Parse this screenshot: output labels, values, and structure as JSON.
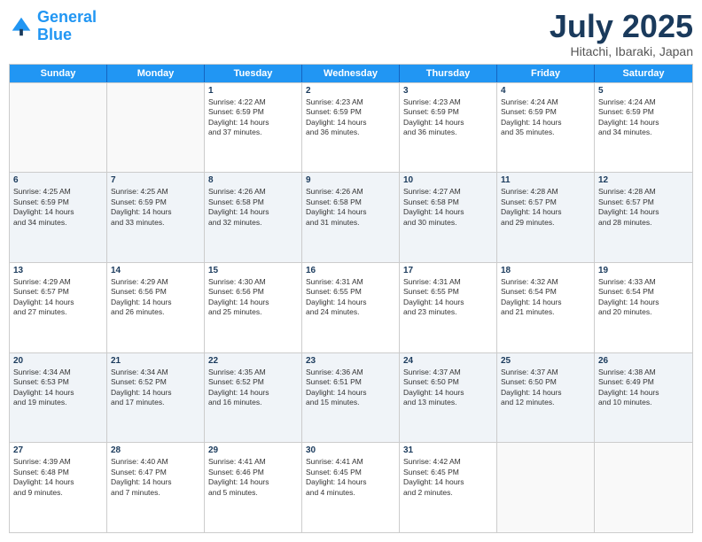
{
  "header": {
    "logo_general": "General",
    "logo_blue": "Blue",
    "month_title": "July 2025",
    "location": "Hitachi, Ibaraki, Japan"
  },
  "weekdays": [
    "Sunday",
    "Monday",
    "Tuesday",
    "Wednesday",
    "Thursday",
    "Friday",
    "Saturday"
  ],
  "rows": [
    [
      {
        "day": "",
        "detail": ""
      },
      {
        "day": "",
        "detail": ""
      },
      {
        "day": "1",
        "detail": "Sunrise: 4:22 AM\nSunset: 6:59 PM\nDaylight: 14 hours\nand 37 minutes."
      },
      {
        "day": "2",
        "detail": "Sunrise: 4:23 AM\nSunset: 6:59 PM\nDaylight: 14 hours\nand 36 minutes."
      },
      {
        "day": "3",
        "detail": "Sunrise: 4:23 AM\nSunset: 6:59 PM\nDaylight: 14 hours\nand 36 minutes."
      },
      {
        "day": "4",
        "detail": "Sunrise: 4:24 AM\nSunset: 6:59 PM\nDaylight: 14 hours\nand 35 minutes."
      },
      {
        "day": "5",
        "detail": "Sunrise: 4:24 AM\nSunset: 6:59 PM\nDaylight: 14 hours\nand 34 minutes."
      }
    ],
    [
      {
        "day": "6",
        "detail": "Sunrise: 4:25 AM\nSunset: 6:59 PM\nDaylight: 14 hours\nand 34 minutes."
      },
      {
        "day": "7",
        "detail": "Sunrise: 4:25 AM\nSunset: 6:59 PM\nDaylight: 14 hours\nand 33 minutes."
      },
      {
        "day": "8",
        "detail": "Sunrise: 4:26 AM\nSunset: 6:58 PM\nDaylight: 14 hours\nand 32 minutes."
      },
      {
        "day": "9",
        "detail": "Sunrise: 4:26 AM\nSunset: 6:58 PM\nDaylight: 14 hours\nand 31 minutes."
      },
      {
        "day": "10",
        "detail": "Sunrise: 4:27 AM\nSunset: 6:58 PM\nDaylight: 14 hours\nand 30 minutes."
      },
      {
        "day": "11",
        "detail": "Sunrise: 4:28 AM\nSunset: 6:57 PM\nDaylight: 14 hours\nand 29 minutes."
      },
      {
        "day": "12",
        "detail": "Sunrise: 4:28 AM\nSunset: 6:57 PM\nDaylight: 14 hours\nand 28 minutes."
      }
    ],
    [
      {
        "day": "13",
        "detail": "Sunrise: 4:29 AM\nSunset: 6:57 PM\nDaylight: 14 hours\nand 27 minutes."
      },
      {
        "day": "14",
        "detail": "Sunrise: 4:29 AM\nSunset: 6:56 PM\nDaylight: 14 hours\nand 26 minutes."
      },
      {
        "day": "15",
        "detail": "Sunrise: 4:30 AM\nSunset: 6:56 PM\nDaylight: 14 hours\nand 25 minutes."
      },
      {
        "day": "16",
        "detail": "Sunrise: 4:31 AM\nSunset: 6:55 PM\nDaylight: 14 hours\nand 24 minutes."
      },
      {
        "day": "17",
        "detail": "Sunrise: 4:31 AM\nSunset: 6:55 PM\nDaylight: 14 hours\nand 23 minutes."
      },
      {
        "day": "18",
        "detail": "Sunrise: 4:32 AM\nSunset: 6:54 PM\nDaylight: 14 hours\nand 21 minutes."
      },
      {
        "day": "19",
        "detail": "Sunrise: 4:33 AM\nSunset: 6:54 PM\nDaylight: 14 hours\nand 20 minutes."
      }
    ],
    [
      {
        "day": "20",
        "detail": "Sunrise: 4:34 AM\nSunset: 6:53 PM\nDaylight: 14 hours\nand 19 minutes."
      },
      {
        "day": "21",
        "detail": "Sunrise: 4:34 AM\nSunset: 6:52 PM\nDaylight: 14 hours\nand 17 minutes."
      },
      {
        "day": "22",
        "detail": "Sunrise: 4:35 AM\nSunset: 6:52 PM\nDaylight: 14 hours\nand 16 minutes."
      },
      {
        "day": "23",
        "detail": "Sunrise: 4:36 AM\nSunset: 6:51 PM\nDaylight: 14 hours\nand 15 minutes."
      },
      {
        "day": "24",
        "detail": "Sunrise: 4:37 AM\nSunset: 6:50 PM\nDaylight: 14 hours\nand 13 minutes."
      },
      {
        "day": "25",
        "detail": "Sunrise: 4:37 AM\nSunset: 6:50 PM\nDaylight: 14 hours\nand 12 minutes."
      },
      {
        "day": "26",
        "detail": "Sunrise: 4:38 AM\nSunset: 6:49 PM\nDaylight: 14 hours\nand 10 minutes."
      }
    ],
    [
      {
        "day": "27",
        "detail": "Sunrise: 4:39 AM\nSunset: 6:48 PM\nDaylight: 14 hours\nand 9 minutes."
      },
      {
        "day": "28",
        "detail": "Sunrise: 4:40 AM\nSunset: 6:47 PM\nDaylight: 14 hours\nand 7 minutes."
      },
      {
        "day": "29",
        "detail": "Sunrise: 4:41 AM\nSunset: 6:46 PM\nDaylight: 14 hours\nand 5 minutes."
      },
      {
        "day": "30",
        "detail": "Sunrise: 4:41 AM\nSunset: 6:45 PM\nDaylight: 14 hours\nand 4 minutes."
      },
      {
        "day": "31",
        "detail": "Sunrise: 4:42 AM\nSunset: 6:45 PM\nDaylight: 14 hours\nand 2 minutes."
      },
      {
        "day": "",
        "detail": ""
      },
      {
        "day": "",
        "detail": ""
      }
    ]
  ]
}
